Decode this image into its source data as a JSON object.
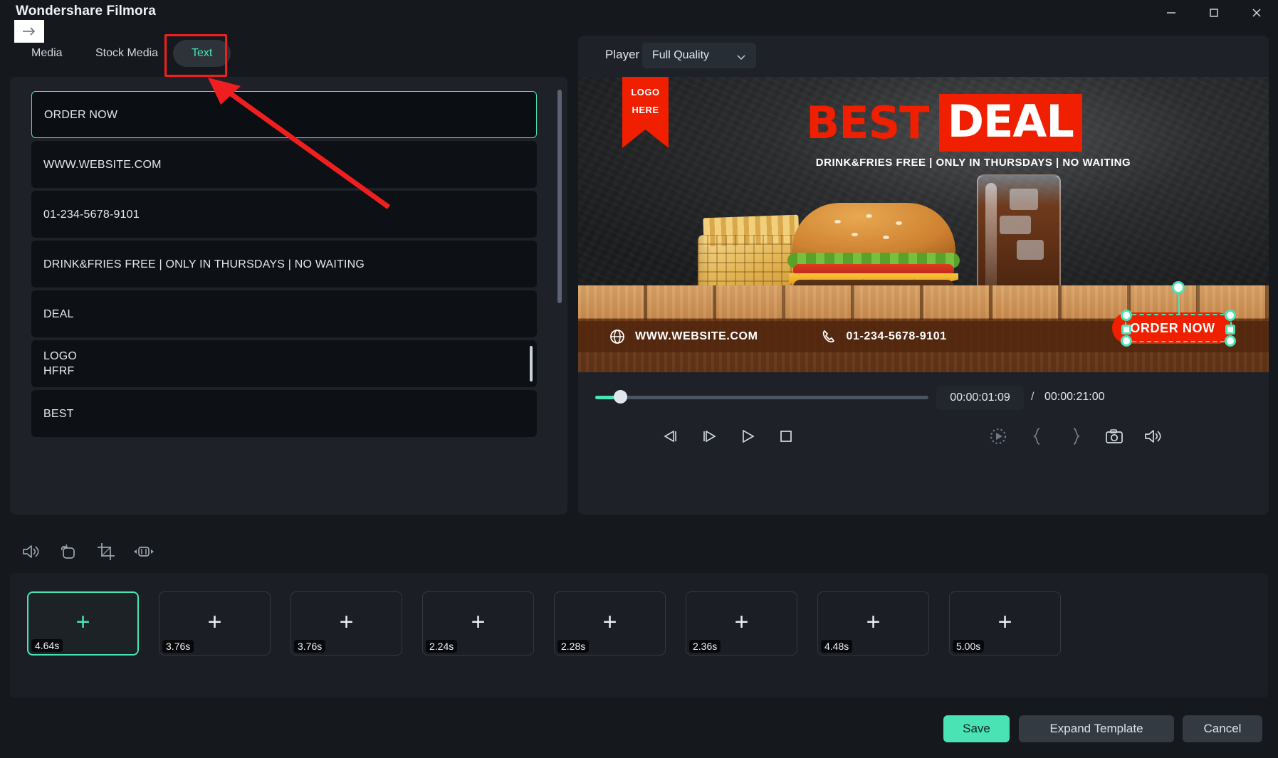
{
  "window": {
    "app_title": "Wondershare Filmora",
    "minimize_icon": "minimize-icon",
    "maximize_icon": "maximize-icon",
    "close_icon": "close-icon",
    "back_icon": "arrow-right-icon"
  },
  "tabs": [
    {
      "label": "Media",
      "selected": false
    },
    {
      "label": "Stock Media",
      "selected": false
    },
    {
      "label": "Text",
      "selected": true
    }
  ],
  "text_list": {
    "items": [
      {
        "lines": [
          "ORDER NOW"
        ],
        "selected": true
      },
      {
        "lines": [
          "WWW.WEBSITE.COM"
        ],
        "selected": false
      },
      {
        "lines": [
          "01-234-5678-9101"
        ],
        "selected": false
      },
      {
        "lines": [
          "DRINK&FRIES FREE | ONLY IN THURSDAYS | NO WAITING"
        ],
        "selected": false
      },
      {
        "lines": [
          "DEAL"
        ],
        "selected": false
      },
      {
        "lines": [
          "LOGO",
          "HFRF"
        ],
        "selected": false
      },
      {
        "lines": [
          "BEST"
        ],
        "selected": false
      }
    ]
  },
  "player": {
    "label": "Player",
    "quality": "Full Quality",
    "quality_chevron": "chevron-down-icon",
    "current_time": "00:00:01:09",
    "time_separator": "/",
    "total_time": "00:00:21:00",
    "transport": [
      {
        "name": "previous-frame-button",
        "glyph": "step-back-icon"
      },
      {
        "name": "next-frame-button",
        "glyph": "step-forward-icon"
      },
      {
        "name": "play-button",
        "glyph": "play-icon"
      },
      {
        "name": "stop-button",
        "glyph": "stop-icon"
      }
    ],
    "right_tools": [
      {
        "name": "render-preview-button",
        "glyph": "render-preview-icon"
      },
      {
        "name": "mark-in-button",
        "glyph": "brace-open-icon"
      },
      {
        "name": "mark-out-button",
        "glyph": "brace-close-icon"
      },
      {
        "name": "snapshot-button",
        "glyph": "camera-icon"
      },
      {
        "name": "volume-button",
        "glyph": "speaker-icon"
      }
    ]
  },
  "preview": {
    "ribbon_line1": "LOGO",
    "ribbon_line2": "HERE",
    "headline_1": "BEST",
    "headline_2": "DEAL",
    "tagline": "DRINK&FRIES FREE | ONLY IN THURSDAYS | NO WAITING",
    "website": "WWW.WEBSITE.COM",
    "phone": "01-234-5678-9101",
    "cta": "ORDER NOW",
    "globe_icon": "globe-icon",
    "phone_icon": "phone-icon",
    "accent_red": "#f01f00",
    "selection_color": "#49e4b4"
  },
  "toolbar": {
    "items": [
      {
        "name": "audio-icon",
        "label": "Audio"
      },
      {
        "name": "rotate-icon",
        "label": "Rotate"
      },
      {
        "name": "crop-icon",
        "label": "Crop"
      },
      {
        "name": "fit-icon",
        "label": "Fit"
      }
    ]
  },
  "timeline": {
    "slots": [
      {
        "duration": "4.64s",
        "selected": true
      },
      {
        "duration": "3.76s",
        "selected": false
      },
      {
        "duration": "3.76s",
        "selected": false
      },
      {
        "duration": "2.24s",
        "selected": false
      },
      {
        "duration": "2.28s",
        "selected": false
      },
      {
        "duration": "2.36s",
        "selected": false
      },
      {
        "duration": "4.48s",
        "selected": false
      },
      {
        "duration": "5.00s",
        "selected": false
      }
    ],
    "add_glyph": "+"
  },
  "footer": {
    "save": "Save",
    "expand_template": "Expand Template",
    "cancel": "Cancel"
  },
  "annotation": {
    "arrow_color": "#f01f1f",
    "highlight_color": "#f01f1f",
    "target": "Text"
  }
}
